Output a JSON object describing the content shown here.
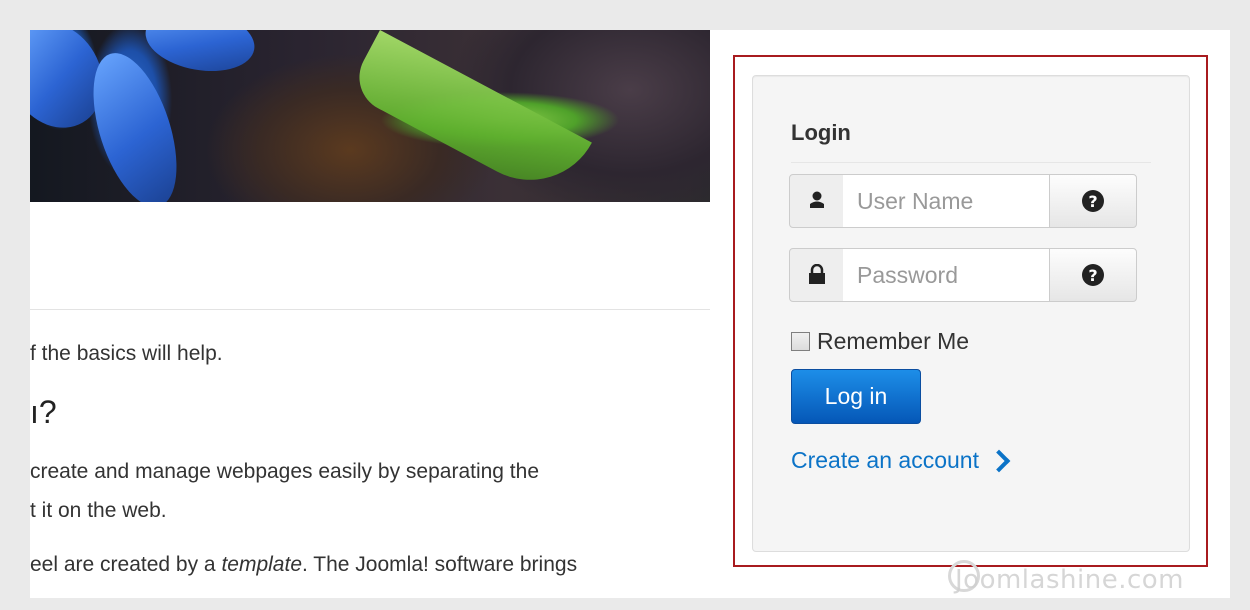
{
  "content": {
    "line1": "f the basics will help.",
    "heading": "ı?",
    "line3": "create and manage webpages easily by separating the",
    "line4": "t it on the web.",
    "line5_before": "eel are created by a ",
    "line5_em": "template",
    "line5_after": ". The Joomla! software brings"
  },
  "login": {
    "title": "Login",
    "username_placeholder": "User Name",
    "password_placeholder": "Password",
    "remember_label": "Remember Me",
    "submit_label": "Log in",
    "create_account_label": "Create an account"
  },
  "icons": {
    "username": "user-icon",
    "password": "lock-icon",
    "help": "question-circle-icon",
    "link_arrow": "chevron-right-icon"
  },
  "colors": {
    "highlight_border": "#a81b1f",
    "button_primary": "#0b6fd0",
    "link": "#0b73c7"
  },
  "watermark": "Joomlashine.com"
}
